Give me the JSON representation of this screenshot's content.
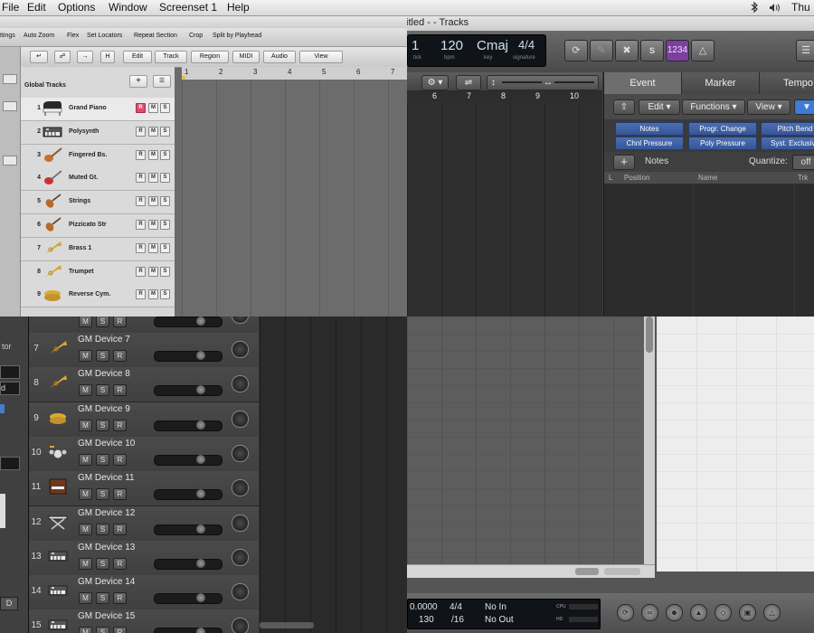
{
  "menubar": {
    "items": [
      "File",
      "Edit",
      "Options",
      "Window",
      "Screenset 1",
      "Help"
    ],
    "right_icons": [
      "bluetooth-icon",
      "volume-icon"
    ],
    "clock": "Thu"
  },
  "top_left": {
    "toolbar_items": [
      "ttings",
      "Auto Zoom",
      "Flex",
      "Set Locators",
      "Repeat Section",
      "Crop",
      "Split by Playhead"
    ],
    "local_menus": [
      "Edit",
      "Track",
      "Region",
      "MIDI",
      "Audio",
      "View"
    ],
    "local_letter_h": "H",
    "global_tracks_label": "Global Tracks",
    "ruler_marks": [
      "1",
      "2",
      "3",
      "4",
      "5",
      "6",
      "7"
    ],
    "tracks": [
      {
        "num": "1",
        "name": "Grand Piano",
        "icon": "grand-piano-icon",
        "selected": true
      },
      {
        "num": "2",
        "name": "Polysynth",
        "icon": "keyboard-synth-icon"
      },
      {
        "num": "3",
        "name": "Fingered Bs.",
        "icon": "bass-guitar-icon"
      },
      {
        "num": "4",
        "name": "Muted Gt.",
        "icon": "electric-guitar-icon"
      },
      {
        "num": "5",
        "name": "Strings",
        "icon": "violin-icon"
      },
      {
        "num": "6",
        "name": "Pizzicato Str",
        "icon": "violin-icon"
      },
      {
        "num": "7",
        "name": "Brass 1",
        "icon": "trumpet-icon"
      },
      {
        "num": "8",
        "name": "Trumpet",
        "icon": "trumpet-icon"
      },
      {
        "num": "9",
        "name": "Reverse Cym.",
        "icon": "cymbal-icon"
      }
    ],
    "rms_labels": [
      "R",
      "M",
      "S"
    ]
  },
  "top_right": {
    "window_title": "Untitled - - Tracks",
    "lcd": {
      "bar": "1",
      "tick_label": "tick",
      "tempo": "120",
      "tempo_label": "bpm",
      "key": "Cmaj",
      "key_label": "key",
      "signature": "4/4",
      "signature_label": "signature"
    },
    "control_buttons": [
      "cycle-icon",
      "pencil-icon",
      "x-icon",
      "S",
      "1234",
      "metronome-icon"
    ],
    "ruler_marks": [
      "6",
      "7",
      "8",
      "9",
      "10"
    ],
    "tabs": [
      "Event",
      "Marker",
      "Tempo"
    ],
    "active_tab": "Event",
    "list_menus": [
      "Edit",
      "Functions",
      "View"
    ],
    "filter_buttons": [
      "Notes",
      "Progr. Change",
      "Pitch Bend",
      "Chnl Pressure",
      "Poly Pressure",
      "Syst. Exclusive"
    ],
    "notes_label": "Notes",
    "quantize_label": "Quantize:",
    "quantize_value": "off",
    "columns": [
      "L",
      "Position",
      "Name",
      "Trk"
    ]
  },
  "bottom_left": {
    "inspector_fragments": [
      "tor",
      "d",
      "D"
    ],
    "tracks": [
      {
        "num": "7",
        "name": "GM Device 7",
        "icon": "trumpet-icon"
      },
      {
        "num": "8",
        "name": "GM Device 8",
        "icon": "trumpet-icon"
      },
      {
        "num": "9",
        "name": "GM Device 9",
        "icon": "cymbal-icon"
      },
      {
        "num": "10",
        "name": "GM Device 10",
        "icon": "drum-kit-icon"
      },
      {
        "num": "11",
        "name": "GM Device 11",
        "icon": "organ-icon"
      },
      {
        "num": "12",
        "name": "GM Device 12",
        "icon": "keyboard-stand-icon"
      },
      {
        "num": "13",
        "name": "GM Device 13",
        "icon": "keyboard-synth-icon"
      },
      {
        "num": "14",
        "name": "GM Device 14",
        "icon": "keyboard-synth-icon"
      },
      {
        "num": "15",
        "name": "GM Device 15",
        "icon": "keyboard-synth-icon"
      }
    ],
    "msr_labels": [
      "M",
      "S",
      "R"
    ]
  },
  "bottom_right": {
    "lcd": {
      "position": "0.0000",
      "tempo": "130",
      "signature_top": "4/4",
      "signature_bottom": "/16",
      "midi_in": "No In",
      "midi_out": "No Out",
      "cpu_label": "CPU",
      "hd_label": "HD"
    },
    "transport_icons": [
      "cycle-icon",
      "loop-icon",
      "people-icon",
      "shield-icon",
      "flex-icon",
      "lock-icon",
      "metronome-icon"
    ]
  },
  "colors": {
    "record_red": "#e0496e",
    "filter_blue": "#3f62a8",
    "purple_count": "#7b3f9e"
  }
}
